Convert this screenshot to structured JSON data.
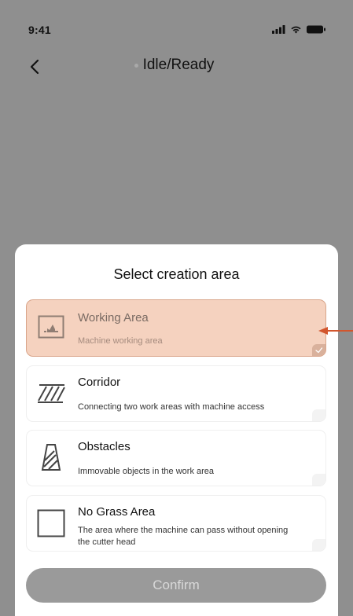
{
  "status_bar": {
    "time": "9:41",
    "icons": [
      "signal-icon",
      "wifi-icon",
      "battery-icon"
    ]
  },
  "nav": {
    "back_icon": "chevron-left-icon",
    "title": "Idle/Ready"
  },
  "sheet": {
    "title": "Select creation area",
    "options": [
      {
        "title": "Working Area",
        "description": "Machine working area",
        "icon": "working-area-icon",
        "selected": true
      },
      {
        "title": "Corridor",
        "description": "Connecting two work areas with machine access",
        "icon": "corridor-icon",
        "selected": false
      },
      {
        "title": "Obstacles",
        "description": "Immovable objects in the work area",
        "icon": "obstacle-icon",
        "selected": false
      },
      {
        "title": "No Grass Area",
        "description": "The area where the machine can pass without opening the cutter head",
        "icon": "no-grass-area-icon",
        "selected": false
      }
    ],
    "confirm_label": "Confirm"
  },
  "colors": {
    "overlay": "#8f8f8f",
    "selected_bg": "#f5d2bf",
    "selected_border": "#d9a58a",
    "annotation_arrow": "#d2562d",
    "confirm_bg": "#9a9a9a"
  }
}
